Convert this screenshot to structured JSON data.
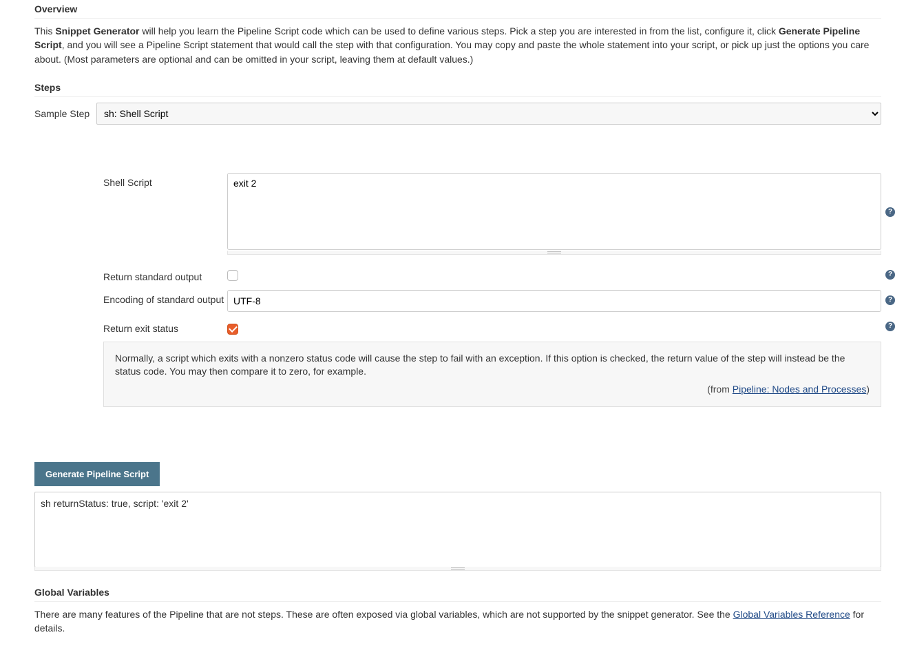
{
  "overview": {
    "title": "Overview",
    "text_pre": "This ",
    "bold1": "Snippet Generator",
    "text_mid1": " will help you learn the Pipeline Script code which can be used to define various steps. Pick a step you are interested in from the list, configure it, click ",
    "bold2": "Generate Pipeline Script",
    "text_mid2": ", and you will see a Pipeline Script statement that would call the step with that configuration. You may copy and paste the whole statement into your script, or pick up just the options you care about. (Most parameters are optional and can be omitted in your script, leaving them at default values.)"
  },
  "steps": {
    "title": "Steps",
    "sample_step_label": "Sample Step",
    "sample_step_value": "sh: Shell Script",
    "shell_script_label": "Shell Script",
    "shell_script_value": "exit 2",
    "return_stdout_label": "Return standard output",
    "return_stdout_checked": false,
    "encoding_label": "Encoding of standard output",
    "encoding_value": "UTF-8",
    "return_status_label": "Return exit status",
    "return_status_checked": true,
    "help_text": "Normally, a script which exits with a nonzero status code will cause the step to fail with an exception. If this option is checked, the return value of the step will instead be the status code. You may then compare it to zero, for example.",
    "help_from_prefix": "(from ",
    "help_from_link": "Pipeline: Nodes and Processes",
    "help_from_suffix": ")"
  },
  "generate": {
    "button_label": "Generate Pipeline Script",
    "output": "sh returnStatus: true, script: 'exit 2'"
  },
  "global": {
    "title": "Global Variables",
    "text_pre": "There are many features of the Pipeline that are not steps. These are often exposed via global variables, which are not supported by the snippet generator. See the ",
    "link": "Global Variables Reference",
    "text_post": " for details."
  }
}
